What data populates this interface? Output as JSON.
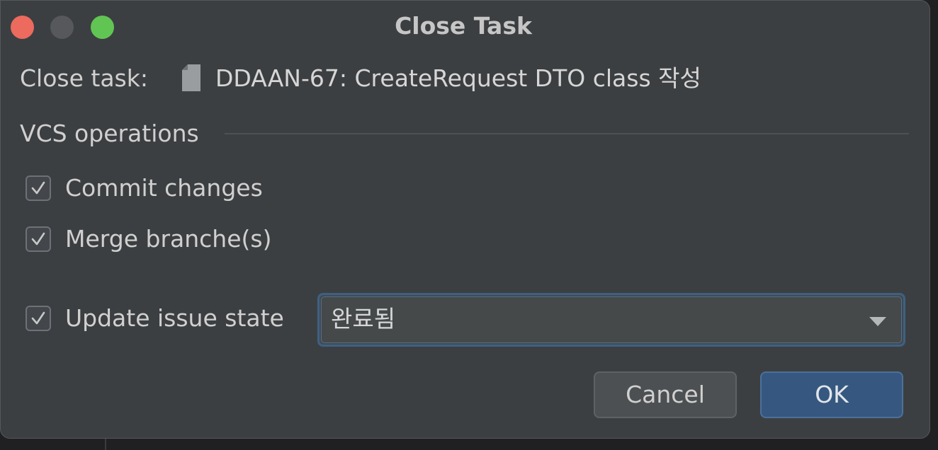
{
  "dialog": {
    "title": "Close Task",
    "colors": {
      "background": "#3c3f41",
      "accent": "#365880",
      "close": "#ec6a5e",
      "minimize": "#56585b",
      "zoom": "#61c554"
    }
  },
  "task": {
    "label": "Close task:",
    "icon": "task-file-icon",
    "name": "DDAAN-67: CreateRequest DTO class 작성"
  },
  "vcs": {
    "section_title": "VCS operations",
    "commit_changes": {
      "label": "Commit changes",
      "checked": true
    },
    "merge_branches": {
      "label": "Merge branche(s)",
      "checked": true
    }
  },
  "issue_state": {
    "label": "Update issue state",
    "checked": true,
    "selected_value": "완료됨"
  },
  "buttons": {
    "cancel": "Cancel",
    "ok": "OK"
  }
}
